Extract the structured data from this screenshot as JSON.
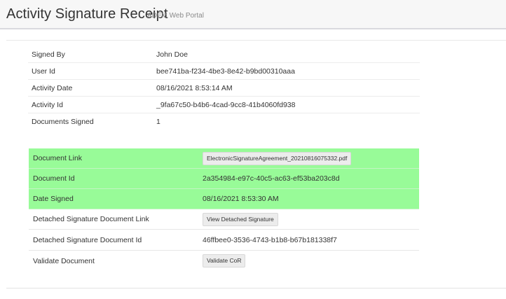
{
  "header": {
    "title": "Activity Signature Receipt",
    "subtitle": "ADEM Web Portal"
  },
  "summary": [
    {
      "label": "Signed By",
      "value": "John Doe"
    },
    {
      "label": "User Id",
      "value": "bee741ba-f234-4be3-8e42-b9bd00310aaa"
    },
    {
      "label": "Activity Date",
      "value": "08/16/2021 8:53:14 AM"
    },
    {
      "label": "Activity Id",
      "value": "_9fa67c50-b4b6-4cad-9cc8-41b4060fd938"
    },
    {
      "label": "Documents Signed",
      "value": "1"
    }
  ],
  "document": {
    "link_label": "Document Link",
    "link_button": "ElectronicSignatureAgreement_20210816075332.pdf",
    "id_label": "Document Id",
    "id_value": "2a354984-e97c-40c5-ac63-ef53ba203c8d",
    "date_label": "Date Signed",
    "date_value": "08/16/2021 8:53:30 AM",
    "detached_link_label": "Detached Signature Document Link",
    "detached_link_button": "View Detached Signature",
    "detached_id_label": "Detached Signature Document Id",
    "detached_id_value": "46ffbee0-3536-4743-b1b8-b67b181338f7",
    "validate_label": "Validate Document",
    "validate_button": "Validate CoR"
  },
  "colors": {
    "highlight": "#98fb98",
    "header_background": "#f7f7f7"
  }
}
